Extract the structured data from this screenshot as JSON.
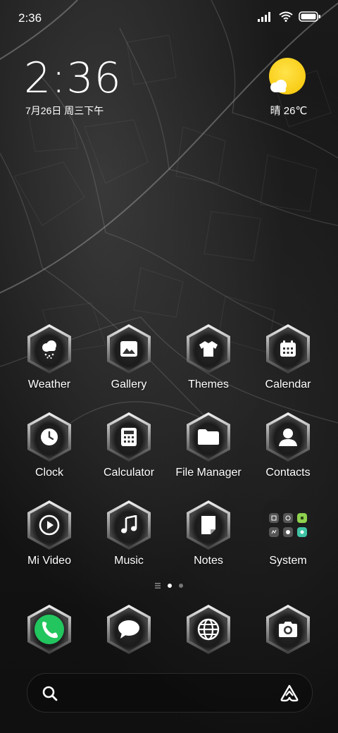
{
  "status_bar": {
    "time": "2:36",
    "icons": [
      "signal-icon",
      "wifi-icon",
      "battery-icon"
    ]
  },
  "clock_widget": {
    "time": "2:36",
    "date": "7月26日 周三下午"
  },
  "weather_widget": {
    "icon": "partly-sunny-icon",
    "summary": "晴 26℃",
    "sun_color": "#F6C300"
  },
  "apps": [
    {
      "label": "Weather",
      "icon": "weather-icon"
    },
    {
      "label": "Gallery",
      "icon": "gallery-icon"
    },
    {
      "label": "Themes",
      "icon": "themes-icon"
    },
    {
      "label": "Calendar",
      "icon": "calendar-icon"
    },
    {
      "label": "Clock",
      "icon": "clock-icon"
    },
    {
      "label": "Calculator",
      "icon": "calculator-icon"
    },
    {
      "label": "File Manager",
      "icon": "folder-icon"
    },
    {
      "label": "Contacts",
      "icon": "contacts-icon"
    },
    {
      "label": "Mi Video",
      "icon": "play-icon"
    },
    {
      "label": "Music",
      "icon": "music-icon"
    },
    {
      "label": "Notes",
      "icon": "notes-icon"
    },
    {
      "label": "System",
      "icon": "system-folder-icon"
    }
  ],
  "page_indicator": {
    "pages": 2,
    "current": 1
  },
  "dock": [
    {
      "icon": "phone-icon",
      "accent": "#22C55E"
    },
    {
      "icon": "messages-icon"
    },
    {
      "icon": "browser-icon"
    },
    {
      "icon": "camera-icon"
    }
  ],
  "search_bar": {
    "search_icon": "search-icon",
    "assistant_icon": "assistant-icon"
  }
}
